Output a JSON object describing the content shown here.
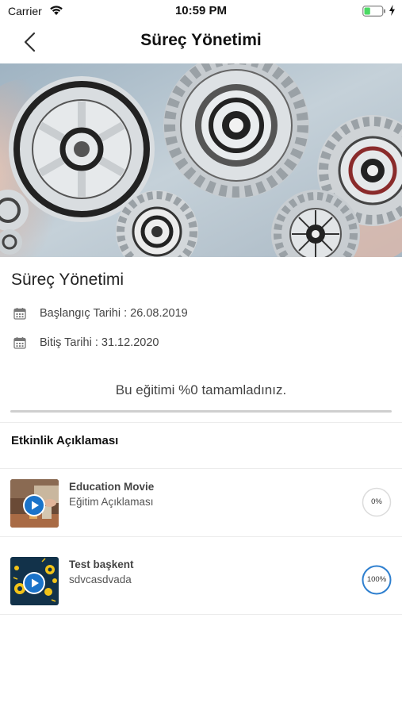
{
  "status_bar": {
    "carrier": "Carrier",
    "time": "10:59 PM",
    "battery_level": 0.35,
    "battery_color": "#4cd964"
  },
  "nav": {
    "title": "Süreç Yönetimi",
    "back_icon": "chevron-left-icon"
  },
  "course": {
    "title": "Süreç Yönetimi",
    "start_date": "Başlangıç Tarihi : 26.08.2019",
    "end_date": "Bitiş Tarihi : 31.12.2020",
    "progress_text": "Bu eğitimi %0 tamamladınız.",
    "progress": 0
  },
  "section": {
    "title": "Etkinlik Açıklaması"
  },
  "activities": [
    {
      "title": "Education Movie",
      "description": "Eğitim Açıklaması",
      "progress_label": "0%",
      "progress": 0
    },
    {
      "title": "Test başkent",
      "description": "sdvcasdvada",
      "progress_label": "100%",
      "progress": 1
    }
  ],
  "colors": {
    "accent": "#2e7fcf",
    "play_button": "#1a73c9"
  }
}
